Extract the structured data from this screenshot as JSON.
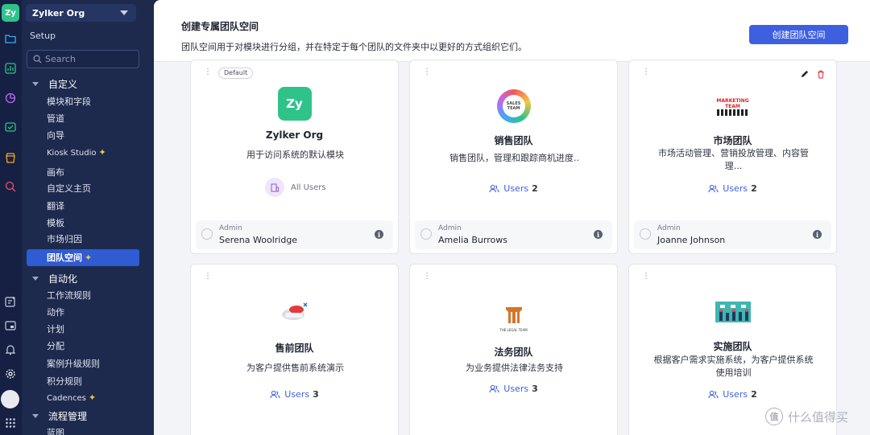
{
  "app": {
    "logo_text": "Zy"
  },
  "sidebar": {
    "org_name": "Zylker Org",
    "section_title": "Setup",
    "search_placeholder": "Search",
    "groups": [
      {
        "label": "自定义",
        "items": [
          "模块和字段",
          "管道",
          "向导",
          "Kiosk Studio",
          "画布",
          "自定义主页",
          "翻译",
          "模板",
          "市场归因",
          "团队空间"
        ]
      },
      {
        "label": "自动化",
        "items": [
          "工作流规则",
          "动作",
          "计划",
          "分配",
          "案例升级规则",
          "积分规则",
          "Cadences"
        ]
      },
      {
        "label": "流程管理",
        "items": [
          "蓝图"
        ]
      }
    ]
  },
  "header": {
    "title": "创建专属团队空间",
    "description": "团队空间用于对模块进行分组，并在特定于每个团队的文件夹中以更好的方式组织它们。",
    "create_button": "创建团队空间"
  },
  "cards": [
    {
      "badge": "Default",
      "logo_text": "Zy",
      "name": "Zylker Org",
      "description": "用于访问系统的默认模块",
      "users_label": "All Users",
      "admin_role": "Admin",
      "admin_name": "Serena Woolridge",
      "logo_color": "#2fc38a"
    },
    {
      "logo_text": "SALES TEAM",
      "name": "销售团队",
      "description": "销售团队，管理和跟踪商机进度..",
      "users_label": "Users",
      "users_count": "2",
      "admin_role": "Admin",
      "admin_name": "Amelia Burrows"
    },
    {
      "logo_text": "MARKETING TEAM",
      "name": "市场团队",
      "description": "市场活动管理、营销投放管理、内容管理...",
      "users_label": "Users",
      "users_count": "2",
      "admin_role": "Admin",
      "admin_name": "Joanne Johnson"
    },
    {
      "name": "售前团队",
      "description": "为客户提供售前系统演示",
      "users_label": "Users",
      "users_count": "3"
    },
    {
      "logo_text": "THE LEGAL TEAM",
      "name": "法务团队",
      "description": "为业务提供法律法务支持",
      "users_label": "Users",
      "users_count": "3"
    },
    {
      "name": "实施团队",
      "description": "根据客户需求实施系统，为客户提供系统使用培训",
      "users_label": "Users",
      "users_count": "2"
    }
  ],
  "watermark": {
    "text": "什么值得买",
    "icon_text": "值"
  }
}
